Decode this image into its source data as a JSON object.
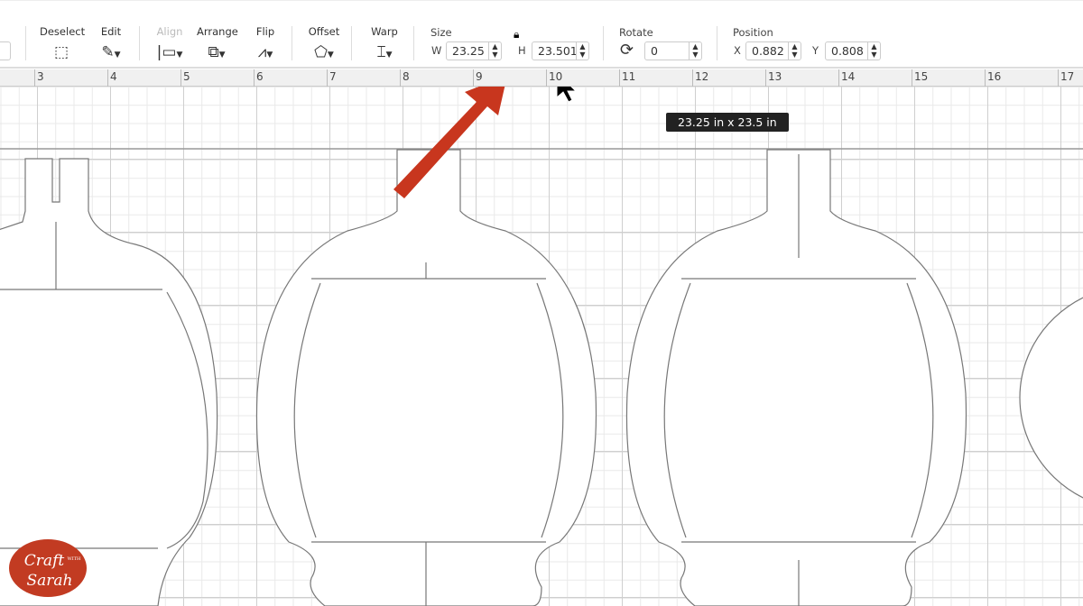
{
  "toolbar": {
    "deselect": "Deselect",
    "edit": "Edit",
    "align": "Align",
    "arrange": "Arrange",
    "flip": "Flip",
    "offset": "Offset",
    "warp": "Warp",
    "size": {
      "label": "Size",
      "w_label": "W",
      "w_value": "23.25",
      "h_label": "H",
      "h_value": "23.501",
      "locked": true
    },
    "rotate": {
      "label": "Rotate",
      "value": "0"
    },
    "position": {
      "label": "Position",
      "x_label": "X",
      "x_value": "0.882",
      "y_label": "Y",
      "y_value": "0.808"
    }
  },
  "ruler": {
    "ticks": [
      "3",
      "4",
      "5",
      "6",
      "7",
      "8",
      "9",
      "10",
      "11",
      "12",
      "13",
      "14",
      "15",
      "16",
      "17"
    ]
  },
  "tooltip": "23.25  in x 23.5  in",
  "annotation_color": "#c8361e",
  "logo": {
    "text": "Craft with Sarah",
    "color": "#c23b22"
  }
}
